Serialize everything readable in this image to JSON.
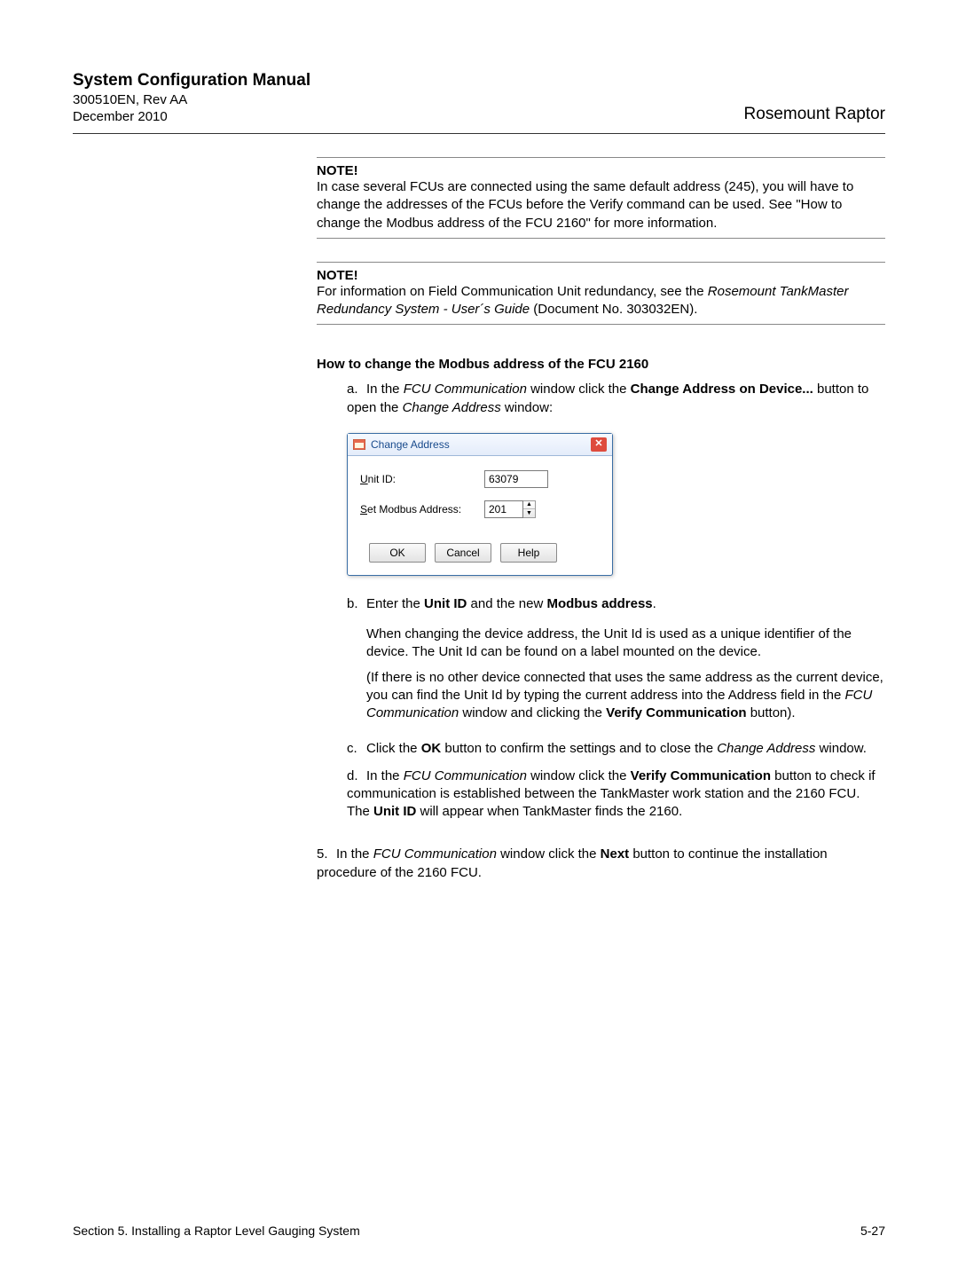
{
  "header": {
    "title": "System Configuration Manual",
    "docnum": "300510EN, Rev AA",
    "date": "December 2010",
    "product": "Rosemount Raptor"
  },
  "note1": {
    "label": "NOTE!",
    "text": "In case several FCUs are connected using the same default address (245), you will have to change the addresses of the FCUs before the Verify command can be used. See \"How to change the Modbus address of the FCU 2160\" for more information."
  },
  "note2": {
    "label": "NOTE!",
    "pre": "For information on Field Communication Unit redundancy, see the ",
    "italic": "Rosemount TankMaster Redundancy System - User´s Guide",
    "post": " (Document No. 303032EN)."
  },
  "howto": "How to change the Modbus address of the FCU 2160",
  "step_a": {
    "marker": "a.",
    "pre": "In the ",
    "it1": "FCU Communication",
    "mid": " window click the ",
    "b1": "Change Address on Device...",
    "mid2": " button to open the ",
    "it2": "Change Address",
    "post": " window:"
  },
  "dialog": {
    "title": "Change Address",
    "unitid_label": "Unit ID:",
    "unitid_value": "63079",
    "modbus_label": "Set Modbus Address:",
    "modbus_value": "201",
    "ok": "OK",
    "cancel": "Cancel",
    "help": "Help"
  },
  "step_b": {
    "marker": "b.",
    "pre": "Enter the ",
    "b1": "Unit ID",
    "mid": " and the new ",
    "b2": "Modbus address",
    "post": "."
  },
  "b_para1": "When changing the device address, the Unit Id is used as a unique identifier of the device. The Unit Id can be found on a label mounted on the device.",
  "b_para2": {
    "pre": "(If there is no other device connected that uses the same address as the current device, you can find the Unit Id by typing the current address into the Address field in the ",
    "it1": "FCU Communication",
    "mid": " window and clicking the ",
    "b1": "Verify Communication",
    "post": " button)."
  },
  "step_c": {
    "marker": "c.",
    "pre": "Click the ",
    "b1": "OK",
    "mid": " button to confirm the settings and to close the ",
    "it1": "Change Address",
    "post": " window."
  },
  "step_d": {
    "marker": "d.",
    "pre": "In the ",
    "it1": "FCU Communication",
    "mid": " window click the ",
    "b1": "Verify Communication",
    "mid2": " button to check if communication is established between the TankMaster work station and the 2160 FCU. The ",
    "b2": "Unit ID",
    "post": " will appear when TankMaster finds the 2160."
  },
  "step5": {
    "marker": "5.",
    "pre": "In the ",
    "it1": "FCU Communication",
    "mid": " window click the ",
    "b1": "Next",
    "post": " button to continue the installation procedure of the 2160 FCU."
  },
  "footer": {
    "left": "Section 5. Installing a Raptor Level Gauging System",
    "right": "5-27"
  }
}
